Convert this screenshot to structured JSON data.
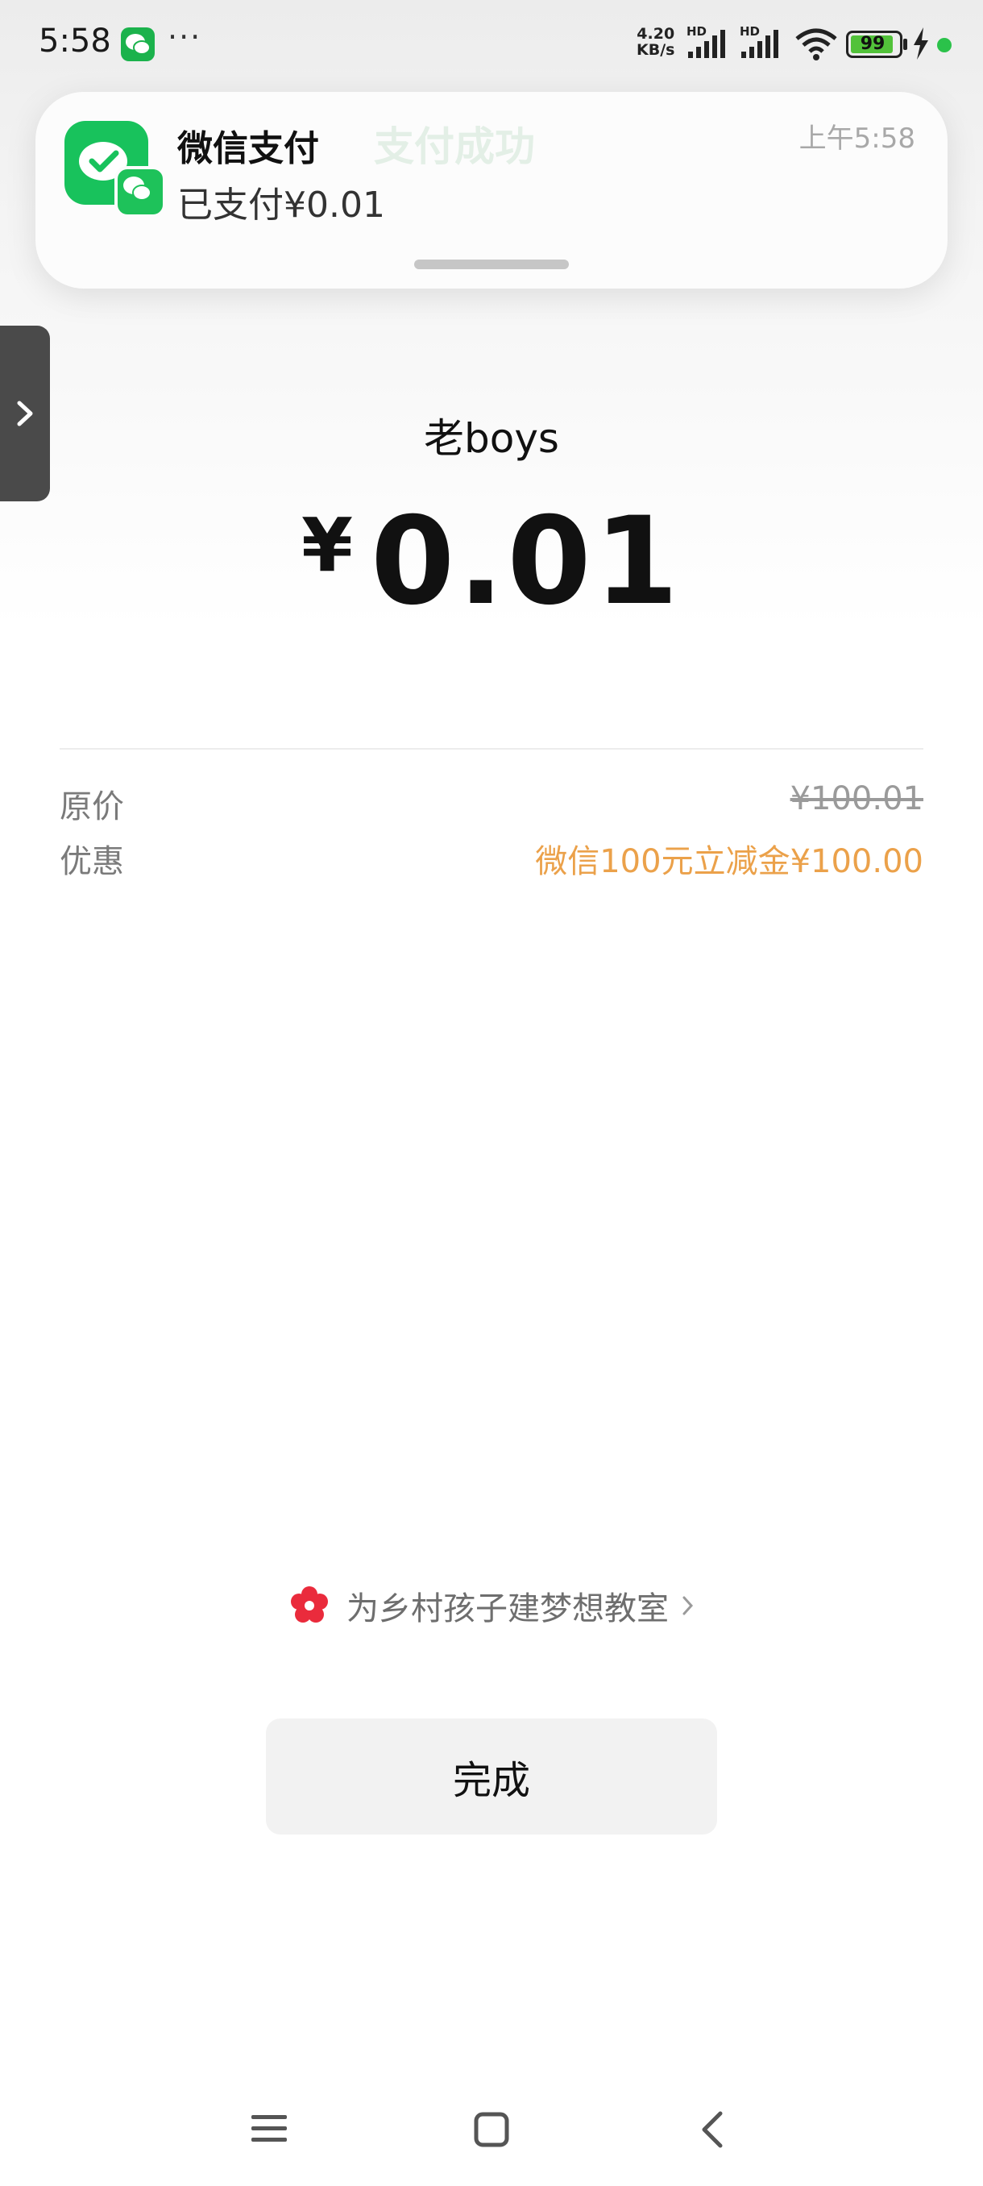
{
  "status_bar": {
    "time": "5:58",
    "net_speed_value": "4.20",
    "net_speed_unit": "KB/s",
    "hd1": "HD",
    "hd2": "HD",
    "battery": "99",
    "app_icon": "wechat-icon"
  },
  "notification": {
    "title": "微信支付",
    "body": "已支付¥0.01",
    "time": "上午5:58",
    "ghost_text": "支付成功"
  },
  "payment": {
    "merchant": "老boys",
    "currency_symbol": "¥",
    "amount": "0.01",
    "rows": [
      {
        "label": "原价",
        "value": "¥100.01"
      },
      {
        "label": "优惠",
        "value": "微信100元立减金¥100.00"
      }
    ]
  },
  "charity": {
    "text": "为乡村孩子建梦想教室"
  },
  "done_button": {
    "label": "完成"
  },
  "colors": {
    "wechat_green": "#18c25c",
    "discount_orange": "#eba14a"
  }
}
